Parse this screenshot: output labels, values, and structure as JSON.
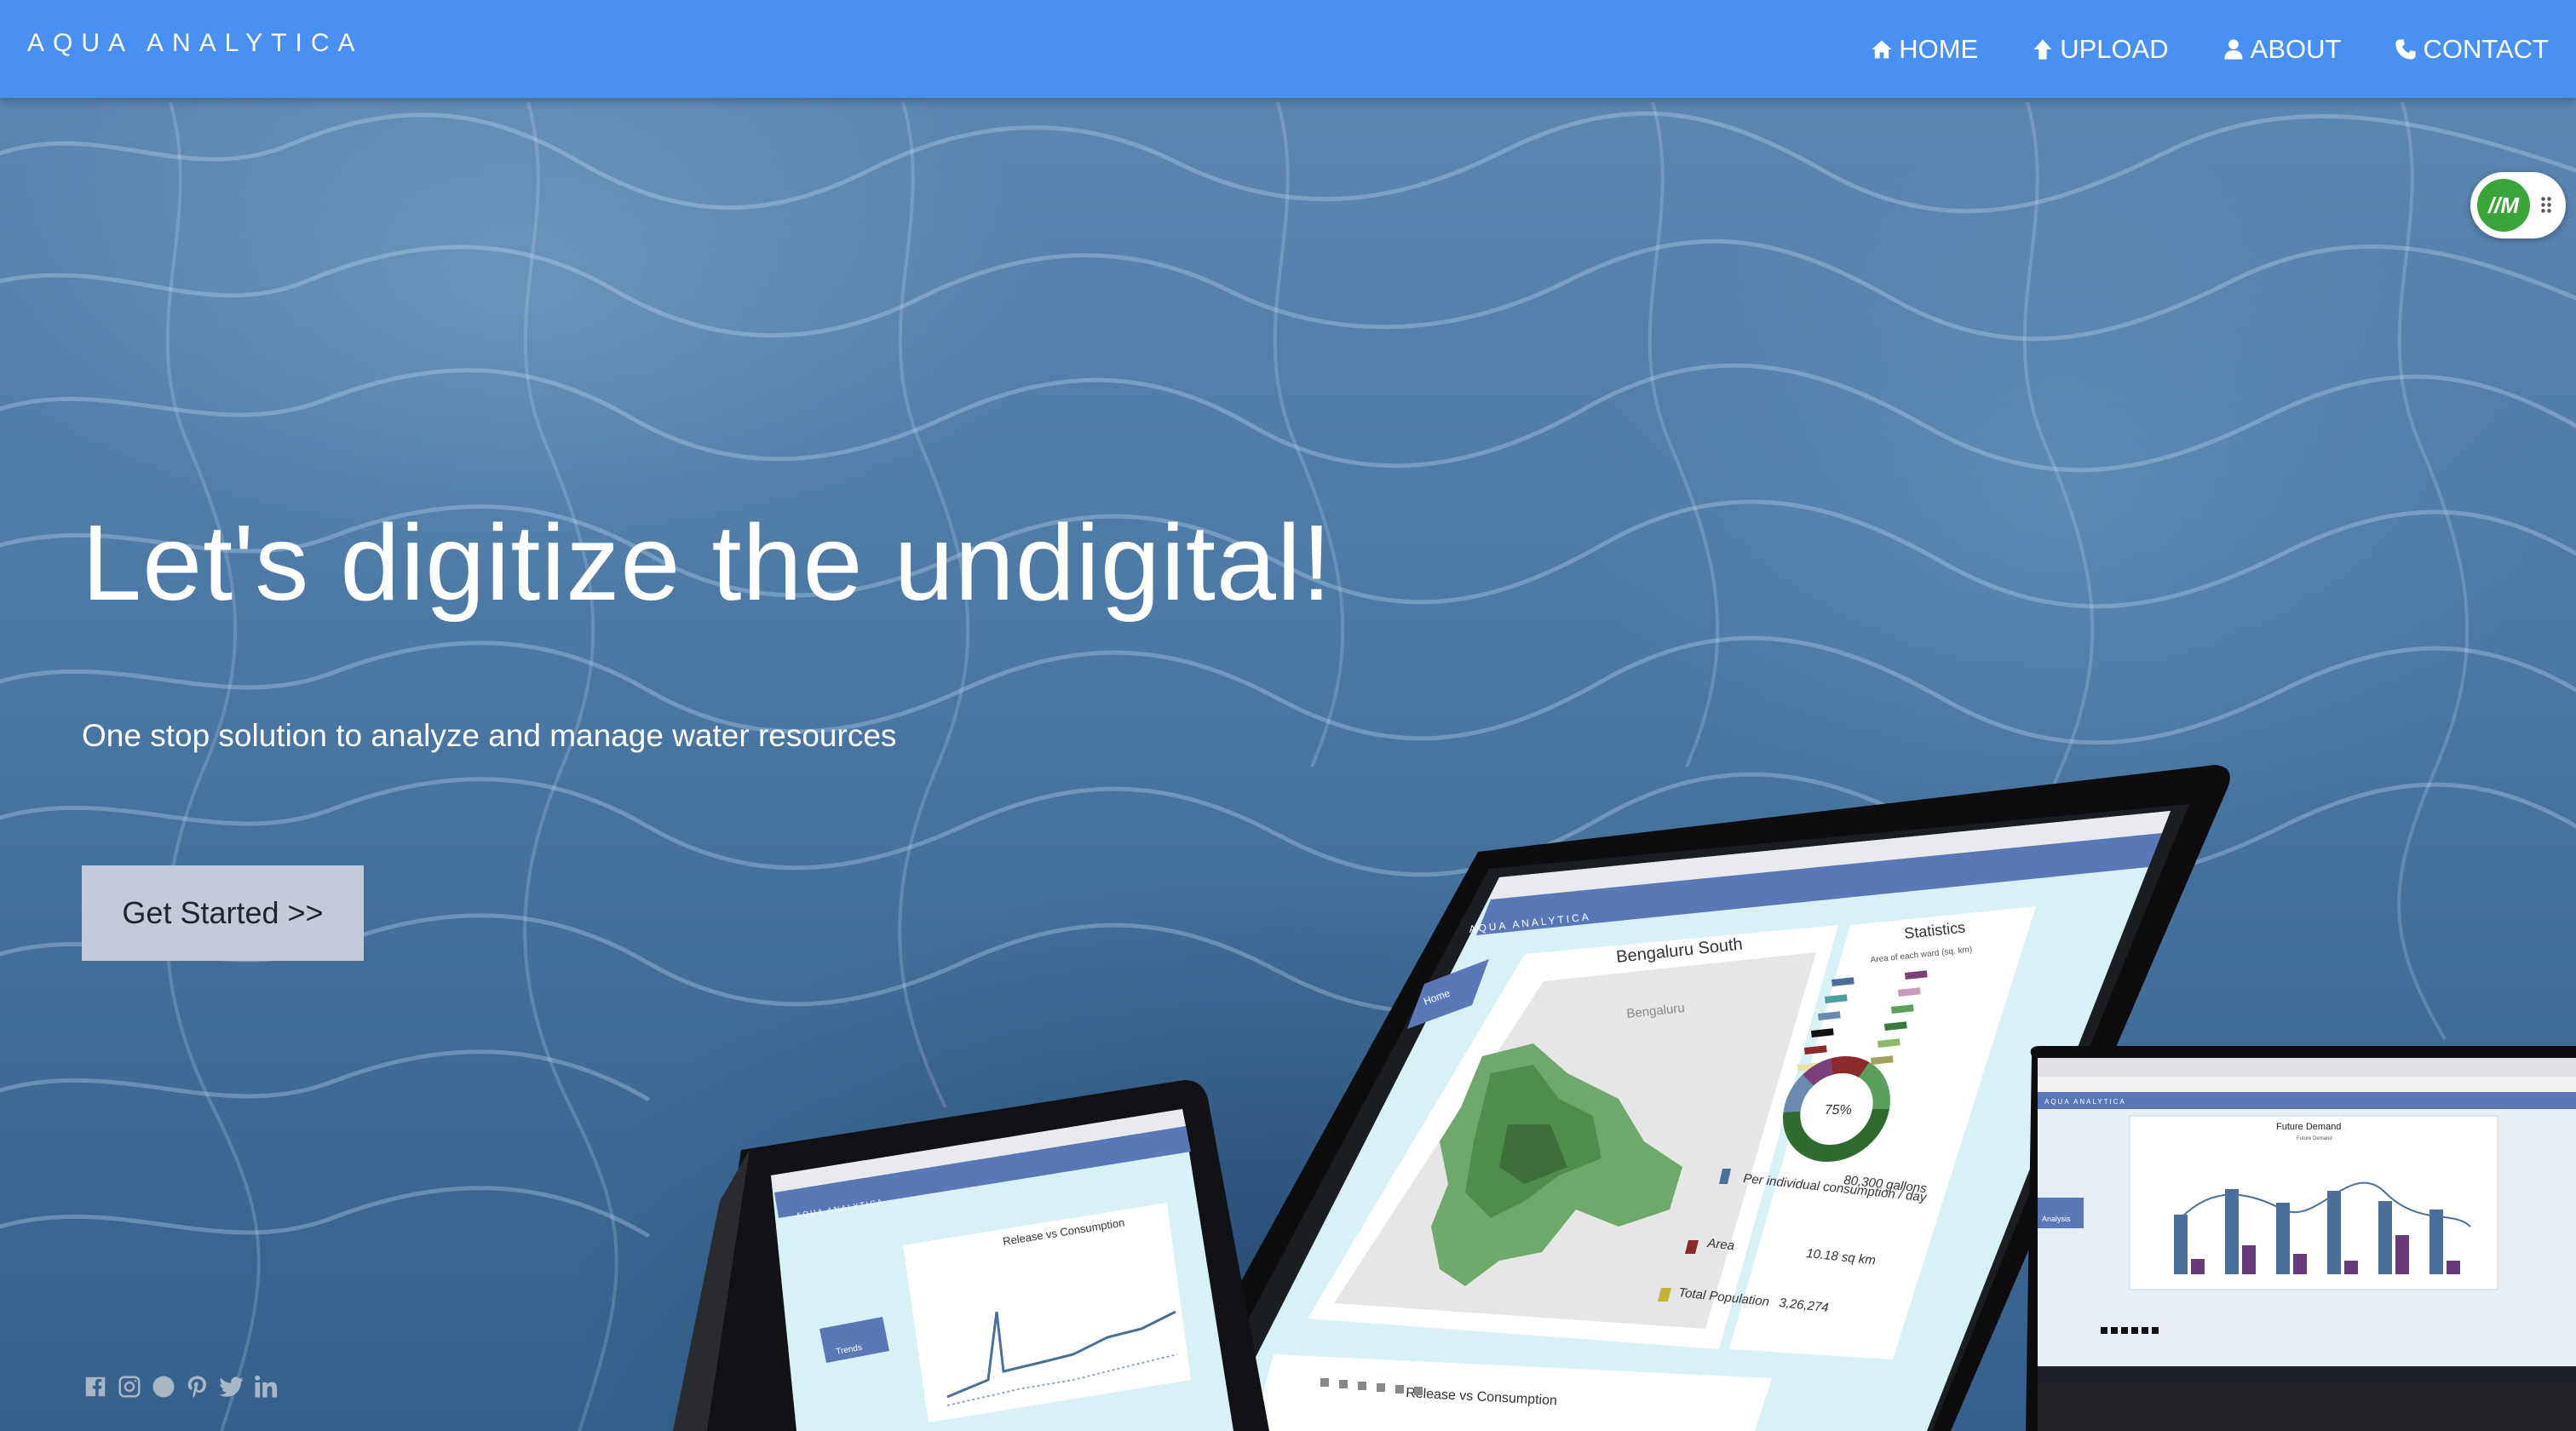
{
  "brand": "AQUA ANALYTICA",
  "nav": [
    {
      "label": "HOME",
      "icon": "home-icon"
    },
    {
      "label": "UPLOAD",
      "icon": "upload-arrow-icon"
    },
    {
      "label": "ABOUT",
      "icon": "user-icon"
    },
    {
      "label": "CONTACT",
      "icon": "phone-icon"
    }
  ],
  "widget": {
    "logo_text": "//M"
  },
  "hero": {
    "title": "Let's digitize the undigital!",
    "subtitle": "One stop solution to analyze and manage water resources",
    "cta_label": "Get Started >>"
  },
  "social": [
    "facebook-icon",
    "instagram-icon",
    "snapchat-icon",
    "pinterest-icon",
    "twitter-icon",
    "linkedin-icon"
  ],
  "mockups": {
    "tablet": {
      "brand": "AQUA ANALYTICA",
      "sidebar_label": "Home",
      "map_title": "Bengaluru South",
      "map_city": "Bengaluru",
      "stats_title": "Statistics",
      "stats_sub": "Area of each ward (sq. km)",
      "donut_label": "75%",
      "stat_rows": [
        {
          "label": "Per individual consumption / day",
          "value": "80,300 gallons"
        },
        {
          "label": "Area",
          "value": "10.18 sq km"
        },
        {
          "label": "Total Population",
          "value": "3,26,274"
        }
      ],
      "bottom_label": "Release vs Consumption"
    },
    "laptop_left": {
      "brand": "AQUA ANALYTICA",
      "chart_title": "Release vs Consumption",
      "sidebar_label": "Trends"
    },
    "laptop_right": {
      "brand": "AQUA ANALYTICA",
      "chart_title": "Future Demand",
      "chart_sub": "Future Demand",
      "sidebar_label": "Analysis"
    }
  },
  "colors": {
    "navbar": "#4a8ff2",
    "cta_bg": "#c3cad8",
    "water": "#4d7aa6"
  }
}
